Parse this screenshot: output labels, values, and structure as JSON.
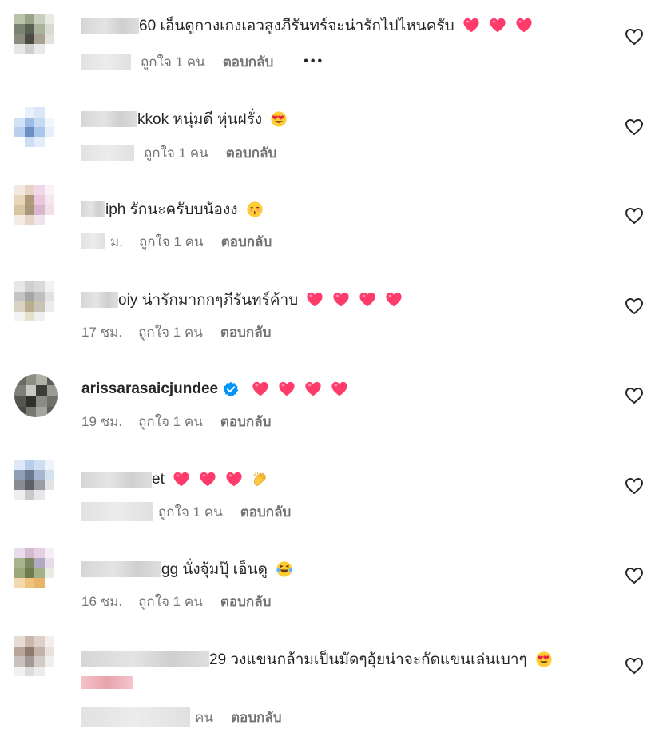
{
  "comments": [
    {
      "id": "c1",
      "username": "",
      "text": "60 เอ็นดูกางเกงเอวสูงภีรันทร์จะน่ารักไปไหนครับ",
      "emojis": [
        "heart",
        "heart",
        "heart"
      ],
      "time": "",
      "likes": "ถูกใจ 1 คน",
      "reply": "ตอบกลับ",
      "more": "•••",
      "avatar_colors": [
        "#b8c5a8",
        "#9aa38a",
        "#c8d0bd",
        "#e8ebe4",
        "#7b8472",
        "#5a6152",
        "#aab39c",
        "#d8dccf",
        "#8e8a7d",
        "#4a4a44",
        "#a9a293",
        "#e3e1da",
        "#e6e6e6",
        "#cfcfcf",
        "#e9e9e9",
        "#ffffff"
      ]
    },
    {
      "id": "c2",
      "username": "",
      "text": "kkok หนุ่มดี หุ่นฝรั่ง",
      "emojis": [
        "heart-eyes"
      ],
      "time": "",
      "likes": "ถูกใจ 1 คน",
      "reply": "ตอบกลับ",
      "avatar_colors": [
        "#ffffff",
        "#e8f0fb",
        "#dbe7f7",
        "#ffffff",
        "#d2e2f6",
        "#9cbde6",
        "#c7daf3",
        "#f3f7fc",
        "#b9d0ef",
        "#6c8fc4",
        "#a9c6ec",
        "#e6eef9",
        "#ffffff",
        "#cddff5",
        "#e4edf9",
        "#ffffff"
      ]
    },
    {
      "id": "c3",
      "username": "",
      "text": "iph รักนะครับบน้องง",
      "emojis": [
        "kissing-face"
      ],
      "time": "ม.",
      "likes": "ถูกใจ 1 คน",
      "reply": "ตอบกลับ",
      "avatar_colors": [
        "#f4e9e0",
        "#e9d2c8",
        "#f0d9e6",
        "#fbf2f7",
        "#e7d6b9",
        "#b49a7c",
        "#e9c8dd",
        "#f6e6ef",
        "#d8c6a3",
        "#a8977a",
        "#d7b7cf",
        "#f1dfea",
        "#f3ebe4",
        "#e4d5cb",
        "#efe4ea",
        "#ffffff"
      ]
    },
    {
      "id": "c4",
      "username": "",
      "text": "oiy น่ารักมากกๆภีรันทร์ค้าบ",
      "emojis": [
        "heart",
        "heart",
        "heart",
        "heart"
      ],
      "time": "17 ชม.",
      "likes": "ถูกใจ 1 คน",
      "reply": "ตอบกลับ",
      "avatar_colors": [
        "#e7e7e7",
        "#cfcfcf",
        "#d9d9d9",
        "#f2f2f2",
        "#c4c4c4",
        "#a6a6a6",
        "#bfbfbf",
        "#e2e2e2",
        "#d8d3c2",
        "#b9ad8e",
        "#c8c3b5",
        "#ececec",
        "#f3f3f3",
        "#e6e0c9",
        "#f0f0f0",
        "#ffffff"
      ]
    },
    {
      "id": "c5",
      "username": "arissarasaicjundee",
      "verified": true,
      "text": "",
      "emojis": [
        "heart",
        "heart",
        "heart",
        "heart"
      ],
      "time": "19 ชม.",
      "likes": "ถูกใจ 1 คน",
      "reply": "ตอบกลับ",
      "avatar_colors": [
        "#6a6b63",
        "#8d8e84",
        "#b0b0a6",
        "#5b5c55",
        "#7e7f76",
        "#c9c8be",
        "#3d3d38",
        "#9a9b91",
        "#55564f",
        "#2f2f2b",
        "#8a8b82",
        "#6f706a",
        "#4a4a45",
        "#777870",
        "#a3a49b",
        "#5c5d57"
      ]
    },
    {
      "id": "c6",
      "username": "",
      "text": "et",
      "emojis": [
        "heart",
        "heart",
        "heart",
        "clap"
      ],
      "time": "",
      "likes": "ถูกใจ 1 คน",
      "reply": "ตอบกลับ",
      "avatar_colors": [
        "#dde9f8",
        "#b7cdea",
        "#cfdff3",
        "#eef4fb",
        "#8f9fb8",
        "#6c7890",
        "#a6b6cf",
        "#d7e2f0",
        "#8a8c94",
        "#5e6068",
        "#9a9ca4",
        "#e2e3e7",
        "#eeeeee",
        "#c9c9cd",
        "#e7e7e9",
        "#ffffff"
      ]
    },
    {
      "id": "c7",
      "username": "",
      "text": "gg นั่งจุ้มปุ๊ เอ็นดู",
      "emojis": [
        "laughing-face"
      ],
      "time": "16 ชม.",
      "likes": "ถูกใจ 1 คน",
      "reply": "ตอบกลับ",
      "avatar_colors": [
        "#eadbe8",
        "#d3b9d0",
        "#e6cfe4",
        "#f7eff6",
        "#a9b48e",
        "#7b8a5f",
        "#b3a9c2",
        "#e5dcec",
        "#9aa87c",
        "#6d7d4e",
        "#a4b08a",
        "#e9ece2",
        "#f4d9b0",
        "#f0c27a",
        "#e7b46a",
        "#ffffff"
      ]
    },
    {
      "id": "c8",
      "username": "",
      "text": "29 วงแขนกล้ามเป็นมัดๆอุ้ยน่าจะกัดแขนเล่นเบาๆ",
      "emojis": [
        "heart-eyes"
      ],
      "time": "",
      "likes": "คน",
      "reply": "ตอบกลับ",
      "avatar_colors": [
        "#e8dcd6",
        "#cbb7ad",
        "#ddd0c9",
        "#f4efec",
        "#b9a59a",
        "#8f7a6e",
        "#c4b2a8",
        "#e9e1dc",
        "#c9c1bd",
        "#a39a95",
        "#d2cbc7",
        "#efefef",
        "#f1f1f1",
        "#dcdcdc",
        "#ececec",
        "#ffffff"
      ]
    }
  ],
  "colors": {
    "heart_red": "#ff3b6b",
    "verified_blue": "#0095f6",
    "meta_gray": "#737373",
    "text_dark": "#262626"
  }
}
